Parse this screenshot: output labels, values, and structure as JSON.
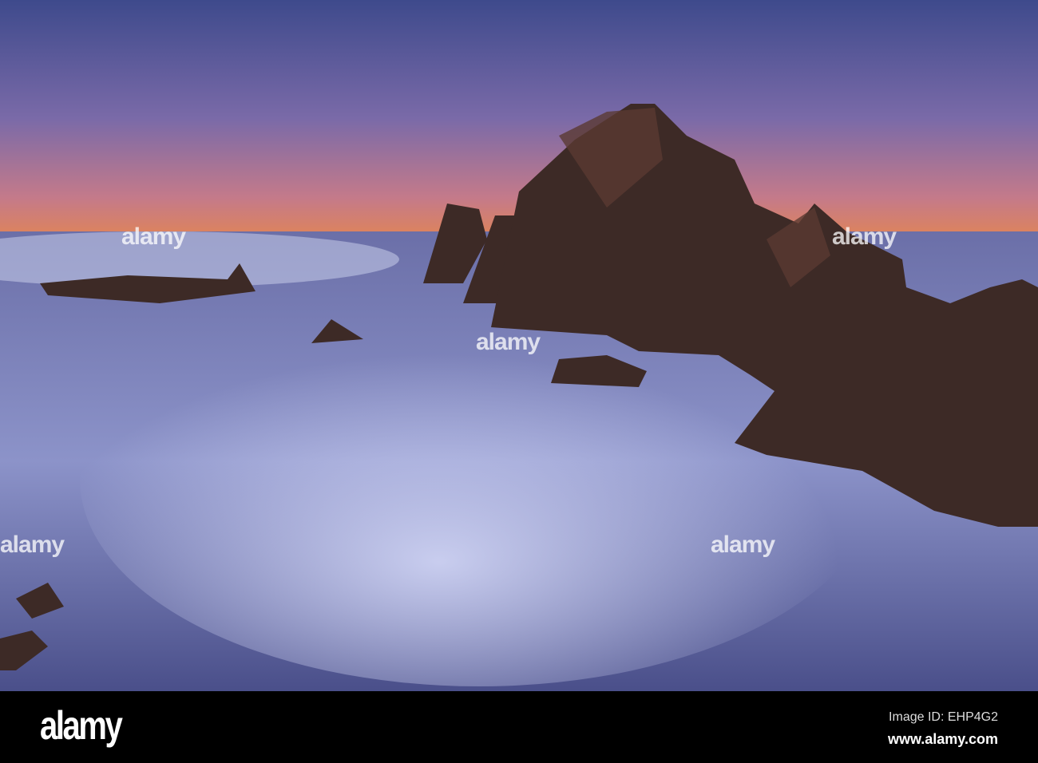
{
  "watermark": {
    "text": "alamy"
  },
  "footer": {
    "logo": "alamy",
    "image_id": "Image ID: EHP4G2",
    "website": "www.alamy.com"
  },
  "colors": {
    "sky_top": "#3f4a8c",
    "sky_horizon": "#f08a3a",
    "water": "#8d94c8",
    "rock": "#3d2a26",
    "footer": "#000000"
  }
}
